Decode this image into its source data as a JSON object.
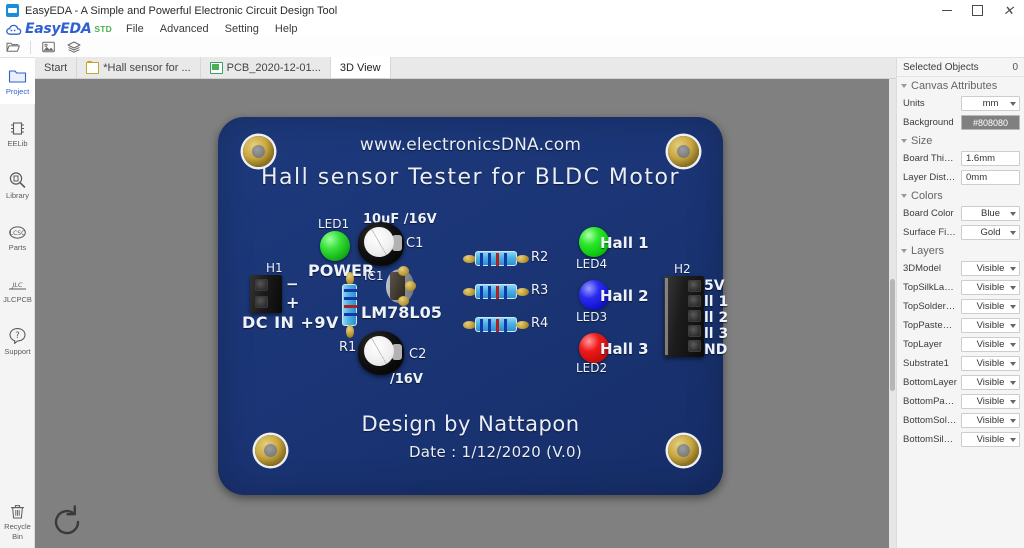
{
  "window": {
    "title": "EasyEDA - A Simple and Powerful Electronic Circuit Design Tool",
    "app_icon": "easyeda-app-icon",
    "minimize": "minimize-button",
    "maximize": "maximize-button",
    "close": "close-button"
  },
  "brand": {
    "name": "EasyEDA",
    "edition": "STD"
  },
  "menu": {
    "items": [
      "File",
      "Advanced",
      "Setting",
      "Help"
    ]
  },
  "toolbar": {
    "buttons": [
      {
        "name": "open-folder-icon",
        "glyph": "folder"
      },
      {
        "name": "export-image-icon",
        "glyph": "image"
      },
      {
        "name": "layers-icon",
        "glyph": "layers"
      }
    ]
  },
  "tabs": [
    {
      "label": "Start",
      "icon": "none",
      "active": false
    },
    {
      "label": "*Hall sensor for ...",
      "icon": "folder",
      "active": false
    },
    {
      "label": "PCB_2020-12-01...",
      "icon": "pcb",
      "active": false
    },
    {
      "label": "3D View",
      "icon": "none",
      "active": true
    }
  ],
  "rail": {
    "items": [
      {
        "label": "Project",
        "icon": "folder-icon",
        "active": true
      },
      {
        "label": "EELib",
        "icon": "chip-icon",
        "active": false
      },
      {
        "label": "Library",
        "icon": "search-library-icon",
        "active": false
      },
      {
        "label": "Parts",
        "icon": "lcsc-parts-icon",
        "active": false
      },
      {
        "label": "JLCPCB",
        "icon": "jlcpcb-icon",
        "active": false
      },
      {
        "label": "Support",
        "icon": "question-icon",
        "active": false
      }
    ],
    "bottom": {
      "label": "Recycle\nBin",
      "label_line1": "Recycle",
      "label_line2": "Bin",
      "icon": "trash-icon"
    }
  },
  "canvas": {
    "background_color": "#808080",
    "refresh_icon": "refresh-rotate-icon"
  },
  "pcb": {
    "board_color": "#1b3576",
    "silkscreen": {
      "url": "www.electronicsDNA.com",
      "title": "Hall sensor Tester for BLDC Motor",
      "designer": "Design by Nattapon",
      "date": "Date : 1/12/2020 (V.0)"
    },
    "components": [
      {
        "ref": "LED1",
        "label": "POWER",
        "type": "led",
        "color": "#22c522"
      },
      {
        "ref": "C1",
        "value": "10uF /16V",
        "type": "capacitor"
      },
      {
        "ref": "C2",
        "value": "/16V",
        "type": "capacitor"
      },
      {
        "ref": "H1",
        "label": "DC IN +9V",
        "type": "header",
        "marks": [
          "−",
          "+"
        ]
      },
      {
        "ref": "R1",
        "type": "resistor"
      },
      {
        "ref": "IC1",
        "label": "LM78L05",
        "type": "to92"
      },
      {
        "ref": "R2",
        "type": "resistor"
      },
      {
        "ref": "R3",
        "type": "resistor"
      },
      {
        "ref": "R4",
        "type": "resistor"
      },
      {
        "ref": "LED4",
        "label": "Hall 1",
        "type": "led",
        "color": "#21e321"
      },
      {
        "ref": "LED3",
        "label": "Hall 2",
        "type": "led",
        "color": "#2020ee"
      },
      {
        "ref": "LED2",
        "label": "Hall 3",
        "type": "led",
        "color": "#ee1212"
      },
      {
        "ref": "H2",
        "type": "header",
        "pins": [
          "5V",
          "ll 1",
          "ll 2",
          "ll 3",
          "ND"
        ]
      }
    ]
  },
  "panel": {
    "header": {
      "label": "Selected Objects",
      "count": "0"
    },
    "groups": [
      {
        "title": "Canvas Attributes",
        "rows": [
          {
            "key": "Units",
            "value": "mm",
            "control": "select"
          },
          {
            "key": "Background",
            "value": "#808080",
            "control": "color"
          }
        ]
      },
      {
        "title": "Size",
        "rows": [
          {
            "key": "Board Thickn...",
            "value": "1.6mm",
            "control": "text"
          },
          {
            "key": "Layer Distance",
            "value": "0mm",
            "control": "text"
          }
        ]
      },
      {
        "title": "Colors",
        "rows": [
          {
            "key": "Board Color",
            "value": "Blue",
            "control": "select"
          },
          {
            "key": "Surface Finis...",
            "value": "Gold",
            "control": "select"
          }
        ]
      },
      {
        "title": "Layers",
        "rows": [
          {
            "key": "3DModel",
            "value": "Visible",
            "control": "select"
          },
          {
            "key": "TopSilkLayer",
            "value": "Visible",
            "control": "select"
          },
          {
            "key": "TopSolderMa...",
            "value": "Visible",
            "control": "select"
          },
          {
            "key": "TopPasteMas...",
            "value": "Visible",
            "control": "select"
          },
          {
            "key": "TopLayer",
            "value": "Visible",
            "control": "select"
          },
          {
            "key": "Substrate1",
            "value": "Visible",
            "control": "select"
          },
          {
            "key": "BottomLayer",
            "value": "Visible",
            "control": "select"
          },
          {
            "key": "BottomPaste...",
            "value": "Visible",
            "control": "select"
          },
          {
            "key": "BottomSolder...",
            "value": "Visible",
            "control": "select"
          },
          {
            "key": "BottomSilkLayer",
            "value": "Visible",
            "control": "select"
          }
        ]
      }
    ]
  }
}
